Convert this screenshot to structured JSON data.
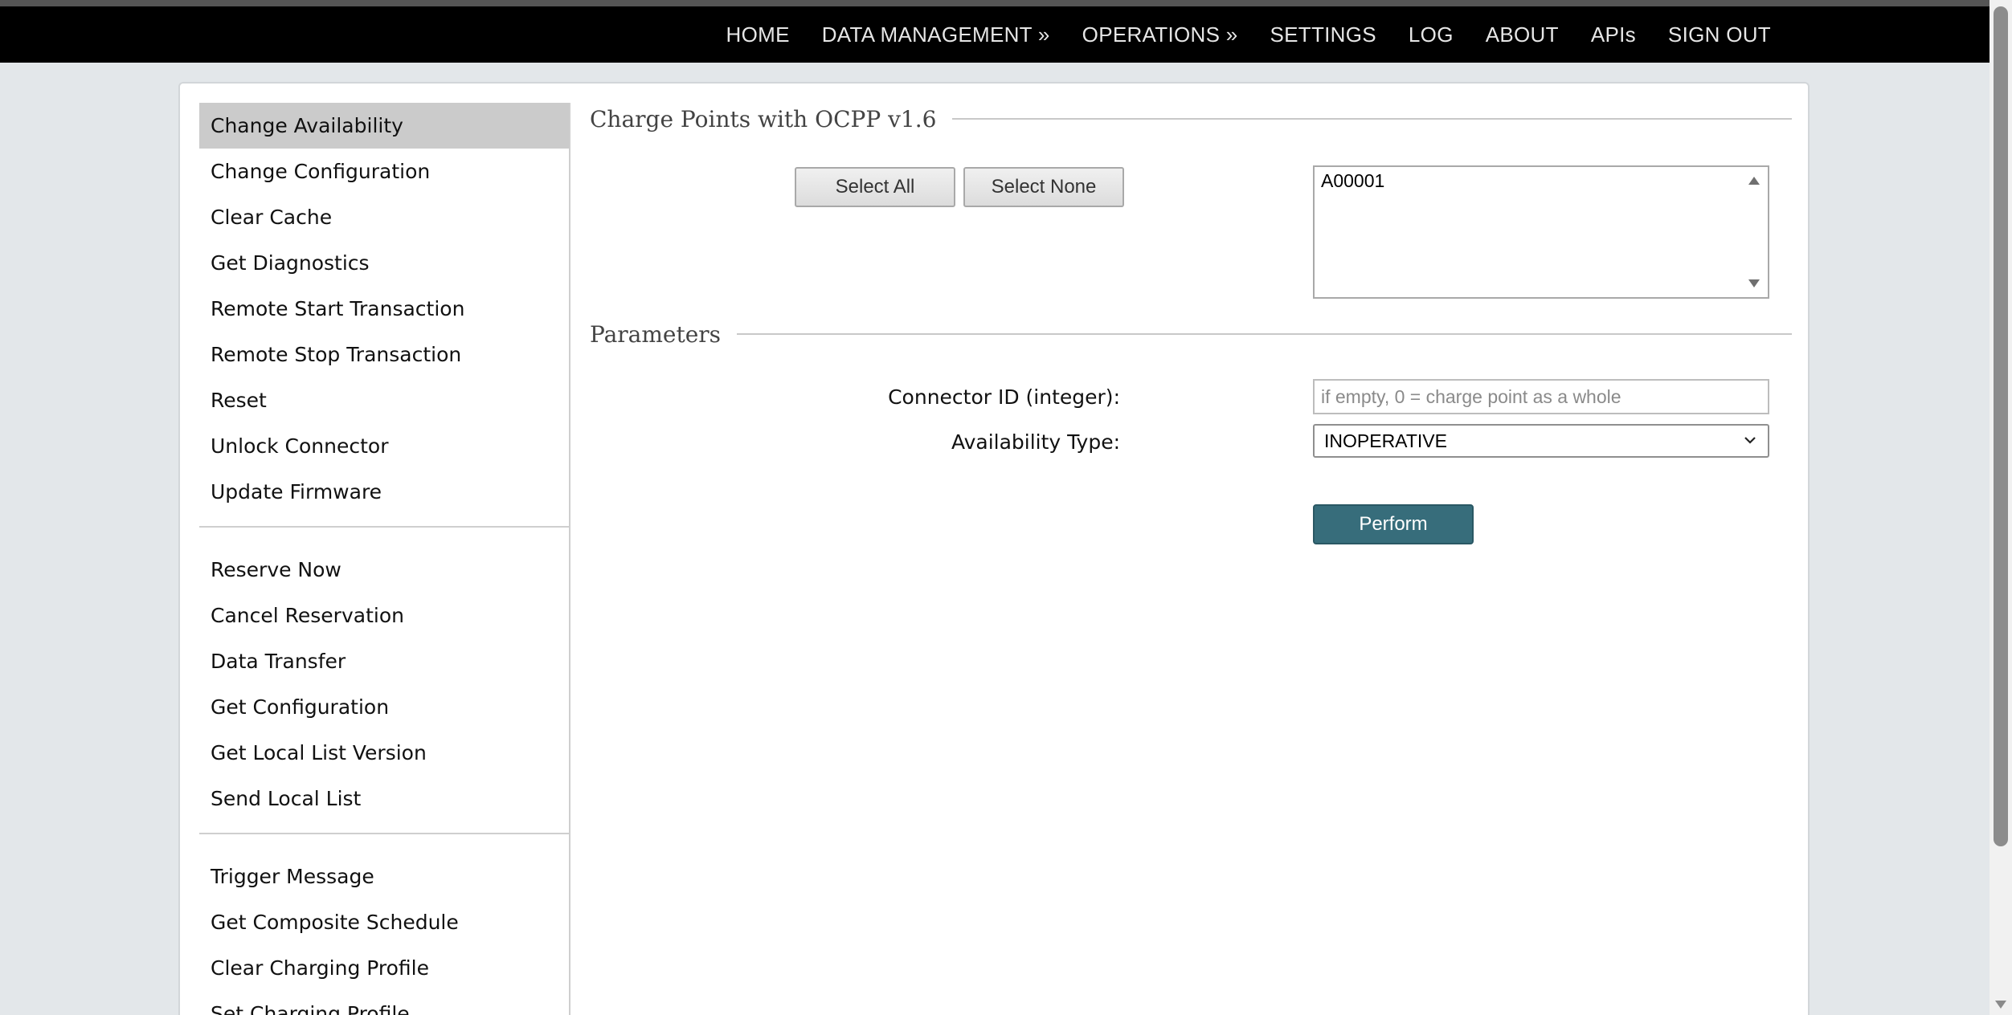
{
  "nav": {
    "items": [
      {
        "label": "HOME"
      },
      {
        "label": "DATA MANAGEMENT »"
      },
      {
        "label": "OPERATIONS »"
      },
      {
        "label": "SETTINGS"
      },
      {
        "label": "LOG"
      },
      {
        "label": "ABOUT"
      },
      {
        "label": "APIs"
      },
      {
        "label": "SIGN OUT"
      }
    ]
  },
  "sidebar": {
    "group1": [
      {
        "label": "Change Availability"
      },
      {
        "label": "Change Configuration"
      },
      {
        "label": "Clear Cache"
      },
      {
        "label": "Get Diagnostics"
      },
      {
        "label": "Remote Start Transaction"
      },
      {
        "label": "Remote Stop Transaction"
      },
      {
        "label": "Reset"
      },
      {
        "label": "Unlock Connector"
      },
      {
        "label": "Update Firmware"
      }
    ],
    "group2": [
      {
        "label": "Reserve Now"
      },
      {
        "label": "Cancel Reservation"
      },
      {
        "label": "Data Transfer"
      },
      {
        "label": "Get Configuration"
      },
      {
        "label": "Get Local List Version"
      },
      {
        "label": "Send Local List"
      }
    ],
    "group3": [
      {
        "label": "Trigger Message"
      },
      {
        "label": "Get Composite Schedule"
      },
      {
        "label": "Clear Charging Profile"
      },
      {
        "label": "Set Charging Profile"
      }
    ],
    "active": "Change Availability"
  },
  "charge_points": {
    "legend": "Charge Points with OCPP v1.6",
    "select_all_label": "Select All",
    "select_none_label": "Select None",
    "options": [
      "A00001"
    ]
  },
  "parameters": {
    "legend": "Parameters",
    "connector_label": "Connector ID (integer):",
    "connector_placeholder": "if empty, 0 = charge point as a whole",
    "availability_label": "Availability Type:",
    "availability_value": "INOPERATIVE",
    "perform_label": "Perform"
  },
  "colors": {
    "nav_bg": "#000000",
    "active_item_bg": "#cbcbcb",
    "perform_bg": "#376d7b",
    "page_bg": "#e3e7ea"
  }
}
